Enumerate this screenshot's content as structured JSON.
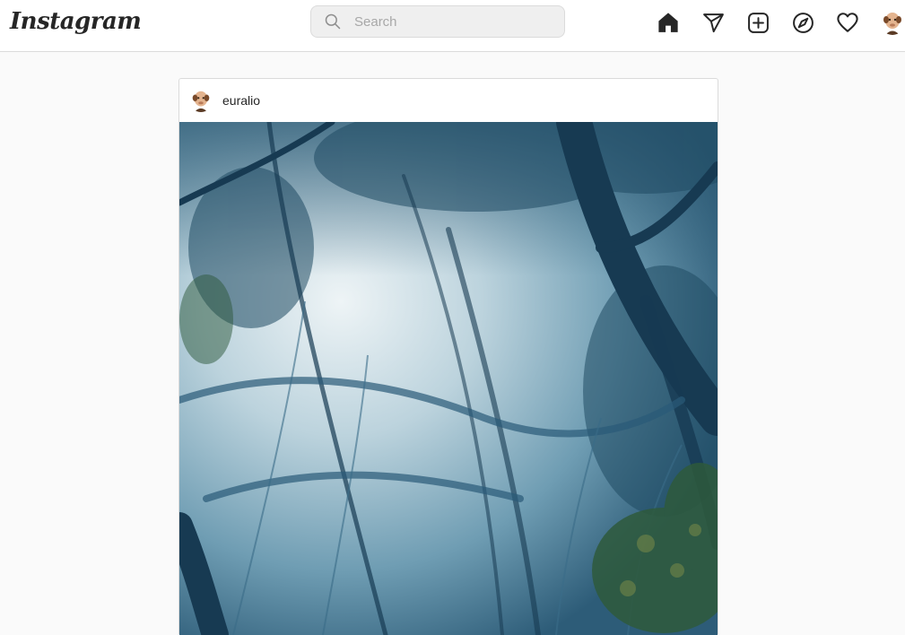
{
  "header": {
    "logo_text": "Instagram",
    "search": {
      "placeholder": "Search",
      "value": ""
    },
    "nav": {
      "icons": [
        "home-icon",
        "direct-message-icon",
        "new-post-icon",
        "explore-icon",
        "activity-heart-icon",
        "profile-avatar"
      ]
    }
  },
  "post": {
    "username": "euralio",
    "image_subject": "misty-forest-photo"
  },
  "colors": {
    "background": "#fafafa",
    "border": "#dbdbdb",
    "search_bg": "#efefef",
    "text": "#262626",
    "placeholder": "#a8a8a8"
  }
}
